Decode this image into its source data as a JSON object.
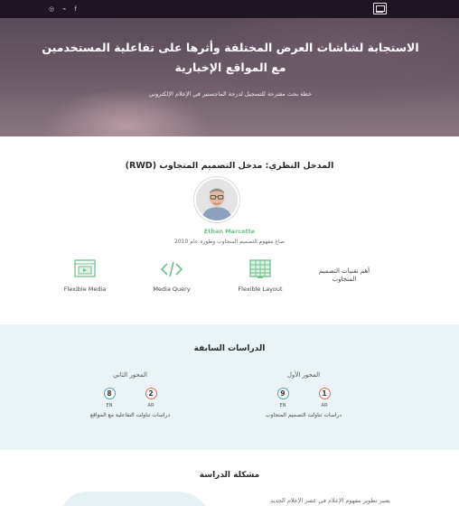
{
  "topbar": {
    "social": [
      {
        "icon": "instagram-icon",
        "glyph": "◎"
      },
      {
        "icon": "twitter-icon",
        "glyph": "🐦"
      },
      {
        "icon": "facebook-icon",
        "glyph": "f"
      }
    ],
    "logo_icon": "site-logo-icon"
  },
  "hero": {
    "title": "الاستجابة لشاشات العرض المختلفة وأثرها على تفاعلية المستخدمين مع المواقع الإخبارية",
    "subtitle": "خطة بحث مقترحة للتسجيل لدرجة الماجستير في الإعلام الإلكتروني"
  },
  "section_rwd": {
    "title": "المدخل النظري: مدخل التصميم المتجاوب (RWD)",
    "person_name": "Ethan Marcotte",
    "person_desc": "صاغ مفهوم التصميم المتجاوب وطوره عام 2010",
    "tech_heading": "أهم تقنيات التصميم المتجاوب",
    "techs": [
      {
        "label": "Flexible Media",
        "icon": "flexible-media-icon"
      },
      {
        "label": "Media Query",
        "icon": "code-icon"
      },
      {
        "label": "Flexible Layout",
        "icon": "grid-layout-icon"
      }
    ]
  },
  "section_prev": {
    "title": "الدراسات السابقة",
    "axes": [
      {
        "name": "المحور الأول",
        "ar": "1",
        "en": "9",
        "ar_label": "AR",
        "en_label": "EN",
        "desc": "دراسات تناولت التصميم المتجاوب"
      },
      {
        "name": "المحور الثاني",
        "ar": "2",
        "en": "8",
        "ar_label": "AR",
        "en_label": "EN",
        "desc": "دراسات تناولت التفاعلية مع المواقع"
      }
    ],
    "colors": {
      "ar": "#e06a5c",
      "en": "#4aa3b5"
    }
  },
  "section_problem": {
    "title": "مشكلة الدراسة",
    "text": "يعتبر تطوير مفهوم الإعلام في عصر الإعلام الجديد"
  }
}
